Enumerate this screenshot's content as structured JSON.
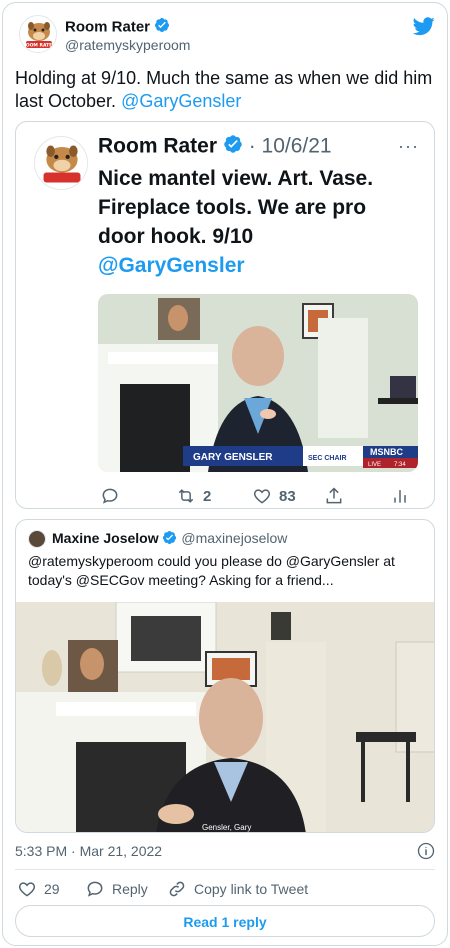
{
  "tweet": {
    "author_name": "Room Rater",
    "author_handle": "@ratemyskyperoom",
    "text_main": "Holding at 9/10. Much the same as when we did him last October.",
    "text_mention": "@GaryGensler",
    "timestamp": "5:33 PM · Mar 21, 2022",
    "likes": "29",
    "reply_label": "Reply",
    "copy_link_label": "Copy link to Tweet",
    "read_replies_label": "Read 1 reply",
    "brand_color": "#1d9bf0"
  },
  "embedded_tweet": {
    "author_name": "Room Rater",
    "date": "· 10/6/21",
    "text": "Nice mantel view. Art. Vase. Fireplace tools. We are pro door hook. 9/10",
    "mention": "@GaryGensler",
    "video_lower_third_name": "GARY GENSLER",
    "video_lower_third_title": "SEC CHAIR",
    "video_network": "MSNBC",
    "video_live": "LIVE",
    "video_time": "7:34",
    "retweets": "2",
    "likes": "83"
  },
  "quote_tweet": {
    "author_name": "Maxine Joselow",
    "author_handle": "@maxinejoselow",
    "text": "@ratemyskyperoom could you please do @GaryGensler at today's @SECGov meeting? Asking for a friend...",
    "video_caption": "Gensler, Gary"
  },
  "avatar": {
    "label": "ROOM RATER"
  }
}
